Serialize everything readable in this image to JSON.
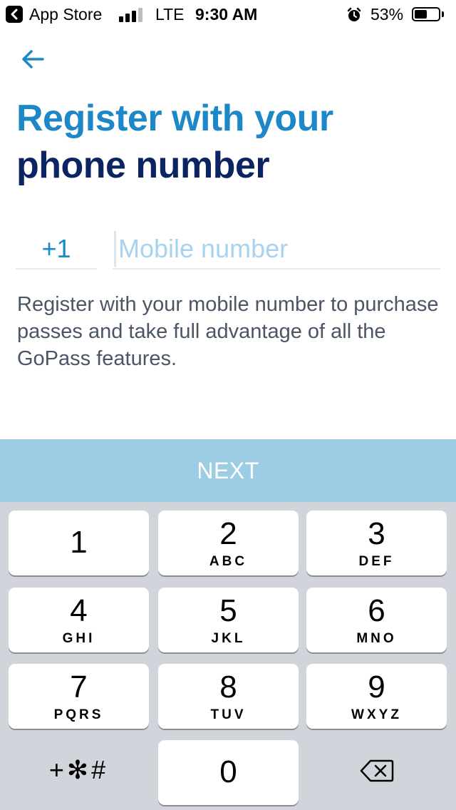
{
  "status_bar": {
    "back_app": "App Store",
    "network": "LTE",
    "time": "9:30 AM",
    "battery_percent": "53%",
    "battery_level": 0.53,
    "signal_bars_active": 3,
    "signal_bars_total": 4
  },
  "header": {
    "title_line1": "Register with your",
    "title_line2": "phone number"
  },
  "form": {
    "country_code": "+1",
    "phone_placeholder": "Mobile number",
    "phone_value": ""
  },
  "description": "Register with your mobile number to purchase passes and take full advantage of all the GoPass features.",
  "next_label": "NEXT",
  "keypad": {
    "keys": [
      {
        "digit": "1",
        "letters": ""
      },
      {
        "digit": "2",
        "letters": "ABC"
      },
      {
        "digit": "3",
        "letters": "DEF"
      },
      {
        "digit": "4",
        "letters": "GHI"
      },
      {
        "digit": "5",
        "letters": "JKL"
      },
      {
        "digit": "6",
        "letters": "MNO"
      },
      {
        "digit": "7",
        "letters": "PQRS"
      },
      {
        "digit": "8",
        "letters": "TUV"
      },
      {
        "digit": "9",
        "letters": "WXYZ"
      },
      {
        "digit": "0",
        "letters": ""
      }
    ],
    "symbols_label": "+✻#",
    "delete_icon": "backspace-icon"
  },
  "colors": {
    "accent_blue": "#1d88c7",
    "navy": "#0c2461",
    "next_button_bg": "#9dcde5",
    "keypad_bg": "#d1d5db"
  }
}
